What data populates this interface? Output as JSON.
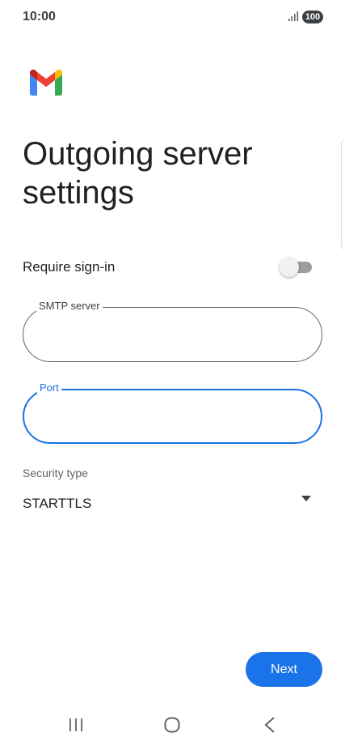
{
  "status_bar": {
    "time": "10:00",
    "battery": "100",
    "signal_icon": "signal-bars-icon"
  },
  "app": {
    "logo_icon": "gmail-logo-icon",
    "brand_colors": {
      "red": "#ea4335",
      "blue": "#4285f4",
      "green": "#34a853",
      "yellow": "#fbbc04",
      "dark_red": "#c5221f"
    }
  },
  "page": {
    "title": "Outgoing server settings"
  },
  "require_signin": {
    "label": "Require sign-in",
    "enabled": false
  },
  "fields": {
    "smtp": {
      "label": "SMTP server",
      "value": ""
    },
    "port": {
      "label": "Port",
      "value": ""
    }
  },
  "security": {
    "label": "Security type",
    "value": "STARTTLS"
  },
  "actions": {
    "next_label": "Next"
  },
  "colors": {
    "accent": "#1a73e8",
    "text_primary": "#202124",
    "text_secondary": "#5f6368"
  },
  "nav_bar": {
    "icons": [
      "recents-icon",
      "home-icon",
      "back-icon"
    ]
  }
}
